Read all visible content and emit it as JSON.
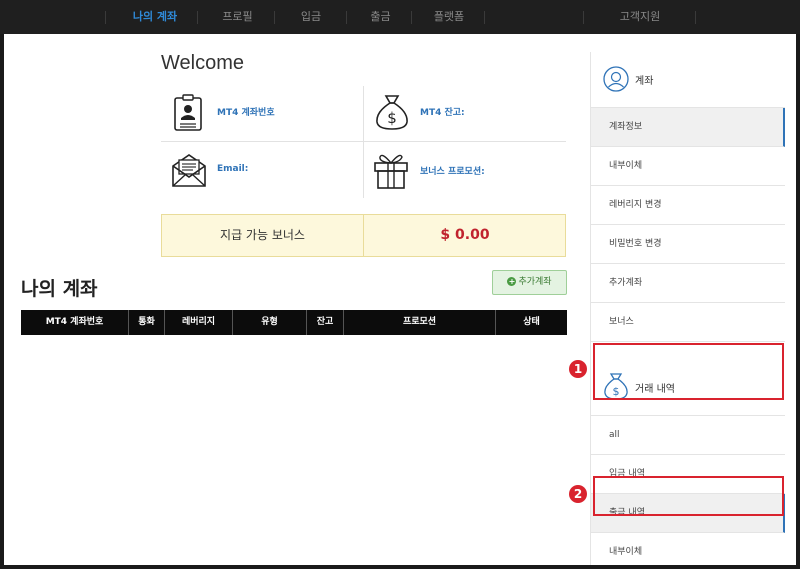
{
  "nav": {
    "items": [
      {
        "label": "나의 계좌",
        "active": true
      },
      {
        "label": "프로필"
      },
      {
        "label": "입금"
      },
      {
        "label": "출금"
      },
      {
        "label": "플랫폼"
      },
      {
        "label": "고객지원"
      }
    ]
  },
  "main": {
    "welcome": "Welcome",
    "info": {
      "account_no_label": "MT4 계좌번호",
      "balance_label": "MT4 잔고:",
      "email_label": "Email:",
      "bonus_promo_label": "보너스 프로모션:"
    },
    "bonus": {
      "label": "지급 가능 보너스",
      "value": "$ 0.00"
    },
    "my_accounts_title": "나의 계좌",
    "add_account_label": "추가계좌",
    "table": {
      "headers": [
        "MT4 계좌번호",
        "통화",
        "레버리지",
        "유형",
        "잔고",
        "프로모션",
        "상태"
      ]
    }
  },
  "sidebar": {
    "account_title": "계좌",
    "account_items": [
      "계좌정보",
      "내부이체",
      "레버리지 변경",
      "비밀번호 변경",
      "추가계좌",
      "보너스"
    ],
    "history_title": "거래 내역",
    "history_items": [
      "all",
      "입금 내역",
      "출금 내역",
      "내부이체"
    ]
  },
  "annotations": {
    "one": "1",
    "two": "2"
  },
  "colors": {
    "accent": "#2f73b7",
    "annotation_red": "#d9232e",
    "bonus_value": "#c0232e"
  }
}
